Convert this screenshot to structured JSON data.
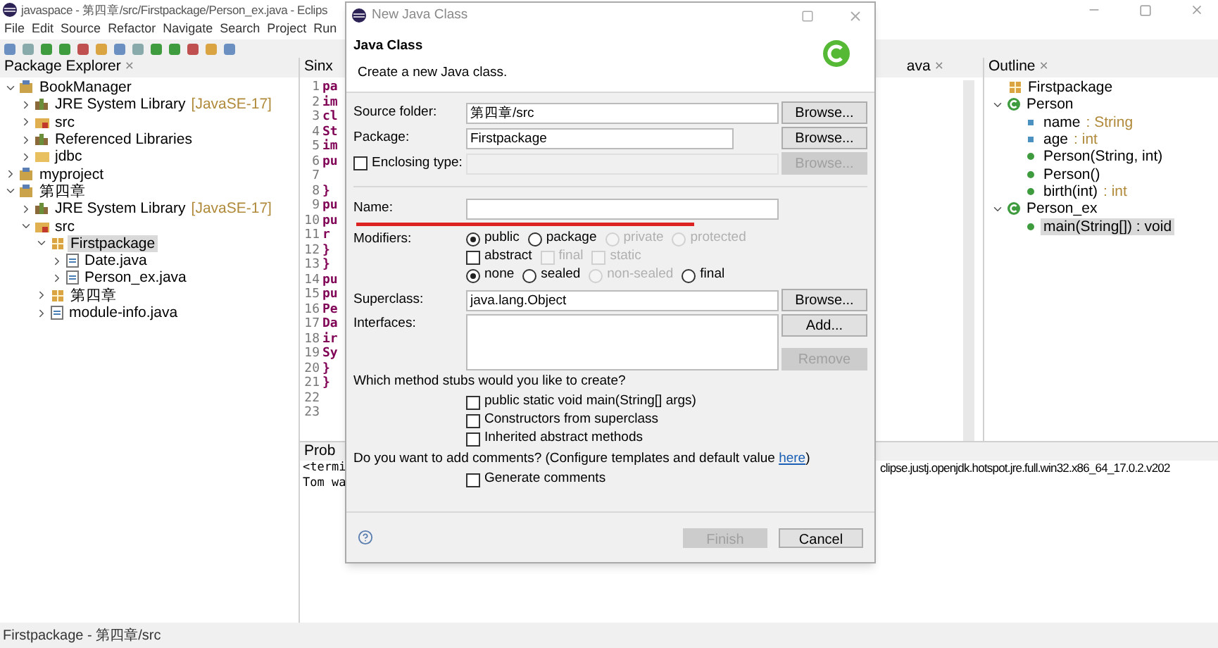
{
  "window": {
    "title": "javaspace - 第四章/src/Firstpackage/Person_ex.java - Eclips"
  },
  "menu": [
    "File",
    "Edit",
    "Source",
    "Refactor",
    "Navigate",
    "Search",
    "Project",
    "Run"
  ],
  "package_explorer": {
    "title": "Package Explorer",
    "close": "×",
    "tree": [
      {
        "label": "BookManager",
        "kind": "project",
        "expanded": true,
        "selected": false,
        "children": [
          {
            "label": "JRE System Library",
            "suffix": "[JavaSE-17]",
            "kind": "library",
            "expanded": false,
            "selected": false
          },
          {
            "label": "src",
            "kind": "srcfolder",
            "expanded": false,
            "selected": false
          },
          {
            "label": "Referenced Libraries",
            "kind": "library",
            "expanded": false,
            "selected": false
          },
          {
            "label": "jdbc",
            "kind": "folder",
            "expanded": false,
            "selected": false
          }
        ]
      },
      {
        "label": "myproject",
        "kind": "project",
        "expanded": false,
        "selected": false
      },
      {
        "label": "第四章",
        "kind": "project",
        "expanded": true,
        "selected": false,
        "children": [
          {
            "label": "JRE System Library",
            "suffix": "[JavaSE-17]",
            "kind": "library",
            "expanded": false,
            "selected": false
          },
          {
            "label": "src",
            "kind": "srcfolder",
            "expanded": true,
            "selected": false,
            "children": [
              {
                "label": "Firstpackage",
                "kind": "package",
                "expanded": true,
                "selected": true,
                "children": [
                  {
                    "label": "Date.java",
                    "kind": "file",
                    "expanded": false,
                    "selected": false
                  },
                  {
                    "label": "Person_ex.java",
                    "kind": "file",
                    "expanded": false,
                    "selected": false
                  }
                ]
              },
              {
                "label": "第四章",
                "kind": "package",
                "expanded": false,
                "selected": false
              },
              {
                "label": "module-info.java",
                "kind": "file",
                "expanded": false,
                "selected": false
              }
            ]
          }
        ]
      }
    ]
  },
  "editor": {
    "tab": "Sinx",
    "right_tab": "ava",
    "right_close": "×",
    "lines": [
      {
        "number": "1",
        "code": "pa"
      },
      {
        "number": "2",
        "code": "im"
      },
      {
        "number": "3",
        "code": "cl"
      },
      {
        "number": "4",
        "code": "St"
      },
      {
        "number": "5",
        "code": "im"
      },
      {
        "number": "6",
        "code": "pu"
      },
      {
        "number": "7"
      },
      {
        "number": "8",
        "code": "}"
      },
      {
        "number": "9",
        "code": "pu"
      },
      {
        "number": "10",
        "code": "pu"
      },
      {
        "number": "11",
        "code": "r"
      },
      {
        "number": "12",
        "code": "}"
      },
      {
        "number": "13",
        "code": "}"
      },
      {
        "number": "14",
        "code": "pu"
      },
      {
        "number": "15",
        "code": "pu"
      },
      {
        "number": "16",
        "code": "Pe"
      },
      {
        "number": "17",
        "code": "Da"
      },
      {
        "number": "18",
        "code": "ir"
      },
      {
        "number": "19",
        "code": "Sy"
      },
      {
        "number": "20",
        "code": "}"
      },
      {
        "number": "21",
        "code": "}"
      },
      {
        "number": "22"
      },
      {
        "number": "23"
      }
    ]
  },
  "outline": {
    "title": "Outline",
    "close": "×",
    "tree": [
      {
        "label": "Firstpackage",
        "kind": "package",
        "selected": false
      },
      {
        "label": "Person",
        "kind": "class",
        "expanded": true,
        "selected": false,
        "children": [
          {
            "label": "name",
            "suffix": ": String",
            "kind": "field",
            "selected": false
          },
          {
            "label": "age",
            "suffix": ": int",
            "kind": "field",
            "selected": false
          },
          {
            "label": "Person(String, int)",
            "kind": "method",
            "selected": false
          },
          {
            "label": "Person()",
            "kind": "method",
            "selected": false
          },
          {
            "label": "birth(int)",
            "suffix": ": int",
            "kind": "method",
            "selected": false
          }
        ]
      },
      {
        "label": "Person_ex",
        "kind": "class",
        "expanded": true,
        "selected": false,
        "children": [
          {
            "label": "main(String[]) : void",
            "kind": "method",
            "selected": true
          }
        ]
      }
    ]
  },
  "console": {
    "tab": "Prob",
    "lines": [
      {
        "left": "<termi",
        "right": "clipse.justj.openjdk.hotspot.jre.full.win32.x86_64_17.0.2.v202"
      },
      {
        "left": "Tom wa"
      }
    ]
  },
  "dialog": {
    "title": "New Java Class",
    "heading": "Java Class",
    "description": "Create a new Java class.",
    "source_folder": {
      "label": "Source folder:",
      "value": "第四章/src",
      "button": "Browse..."
    },
    "package": {
      "label": "Package:",
      "value": "Firstpackage",
      "button": "Browse..."
    },
    "enclosing_type": {
      "label": "Enclosing type:",
      "checked": false,
      "button": "Browse...",
      "button_disabled": true
    },
    "name": {
      "label": "Name:"
    },
    "modifiers": {
      "label": "Modifiers:",
      "access": [
        {
          "label": "public",
          "selected": true,
          "disabled": false
        },
        {
          "label": "package",
          "selected": false,
          "disabled": false
        },
        {
          "label": "private",
          "selected": false,
          "disabled": true
        },
        {
          "label": "protected",
          "selected": false,
          "disabled": true
        }
      ],
      "flags": [
        {
          "label": "abstract",
          "checked": false,
          "disabled": false
        },
        {
          "label": "final",
          "checked": false,
          "disabled": true
        },
        {
          "label": "static",
          "checked": false,
          "disabled": true
        }
      ],
      "sealing": [
        {
          "label": "none",
          "selected": true,
          "disabled": false
        },
        {
          "label": "sealed",
          "selected": false,
          "disabled": false
        },
        {
          "label": "non-sealed",
          "selected": false,
          "disabled": true
        },
        {
          "label": "final",
          "selected": false,
          "disabled": false
        }
      ]
    },
    "superclass": {
      "label": "Superclass:",
      "value": "java.lang.Object",
      "button": "Browse..."
    },
    "interfaces": {
      "label": "Interfaces:",
      "buttons": [
        {
          "label": "Add...",
          "disabled": false
        },
        {
          "label": "Remove",
          "disabled": true
        }
      ]
    },
    "stubs": {
      "question": "Which method stubs would you like to create?",
      "options": [
        {
          "label": "public static void main(String[] args)",
          "checked": false
        },
        {
          "label": "Constructors from superclass",
          "checked": false
        },
        {
          "label": "Inherited abstract methods",
          "checked": false
        }
      ]
    },
    "comments": {
      "question": "Do you want to add comments? (Configure templates and default value ",
      "link": "here",
      "question_end": ")",
      "options": [
        {
          "label": "Generate comments",
          "checked": false
        }
      ]
    },
    "buttons": [
      {
        "label": "Finish",
        "disabled": true
      },
      {
        "label": "Cancel",
        "disabled": false
      }
    ]
  },
  "status_bar": "Firstpackage - 第四章/src"
}
